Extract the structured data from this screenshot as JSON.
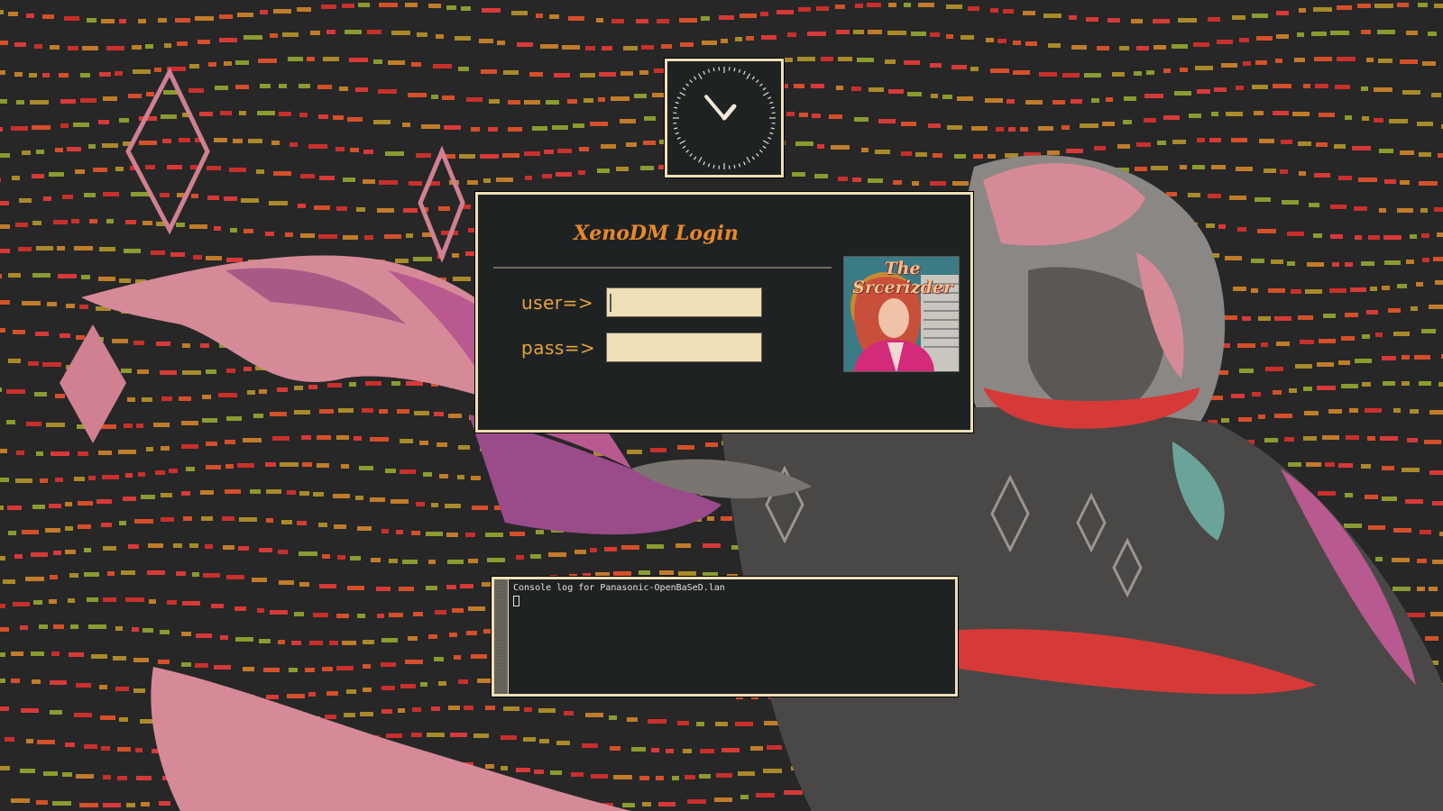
{
  "login": {
    "title": "XenoDM Login",
    "user_label": "user=>",
    "pass_label": "pass=>",
    "user_value": "",
    "pass_value": ""
  },
  "avatar": {
    "caption_line1": "The",
    "caption_line2": "Srcerizder"
  },
  "console": {
    "log_title": "Console log for Panasonic-OpenBaSeD.lan"
  },
  "clock": {
    "hour_hand_deg": 40,
    "minute_hand_deg": -40
  },
  "colors": {
    "panel_bg": "#1f2223",
    "panel_border": "#efdfb7",
    "accent_orange": "#e8892a",
    "label_orange": "#e8a33d",
    "input_bg": "#efdfb7",
    "wallpaper_bg": "#272727"
  },
  "icons": {
    "clock": "analog-clock-icon",
    "avatar": "user-avatar-image"
  }
}
